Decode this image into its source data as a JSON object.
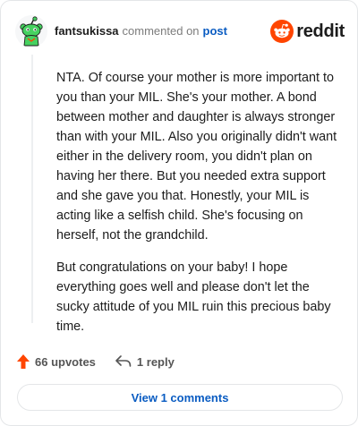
{
  "header": {
    "username": "fantsukissa",
    "action": "commented on",
    "link": "post",
    "brand": "reddit"
  },
  "comment": {
    "paragraphs": [
      "NTA. Of course your mother is more important to you than your MIL. She's your mother. A bond between mother and daughter is always stronger than with your MIL. Also you originally didn't want either in the delivery room, you didn't plan on having her there. But you needed extra support and she gave you that. Honestly, your MIL is acting like a selfish child. She's focusing on herself, not the grandchild.",
      "But congratulations on your baby! I hope everything goes well and please don't let the sucky attitude of you MIL ruin this precious baby time."
    ]
  },
  "actions": {
    "upvotes": "66 upvotes",
    "replies": "1 reply"
  },
  "footer": {
    "view_button": "View 1 comments"
  },
  "colors": {
    "brand": "#ff4500",
    "link": "#0a5cc2",
    "avatar_bg": "#ffffff",
    "snoo": "#46d160"
  },
  "icons": {
    "avatar": "snoo-avatar-icon",
    "brand": "reddit-logo-icon",
    "upvote": "upvote-arrow-icon",
    "reply": "reply-arrow-icon"
  }
}
